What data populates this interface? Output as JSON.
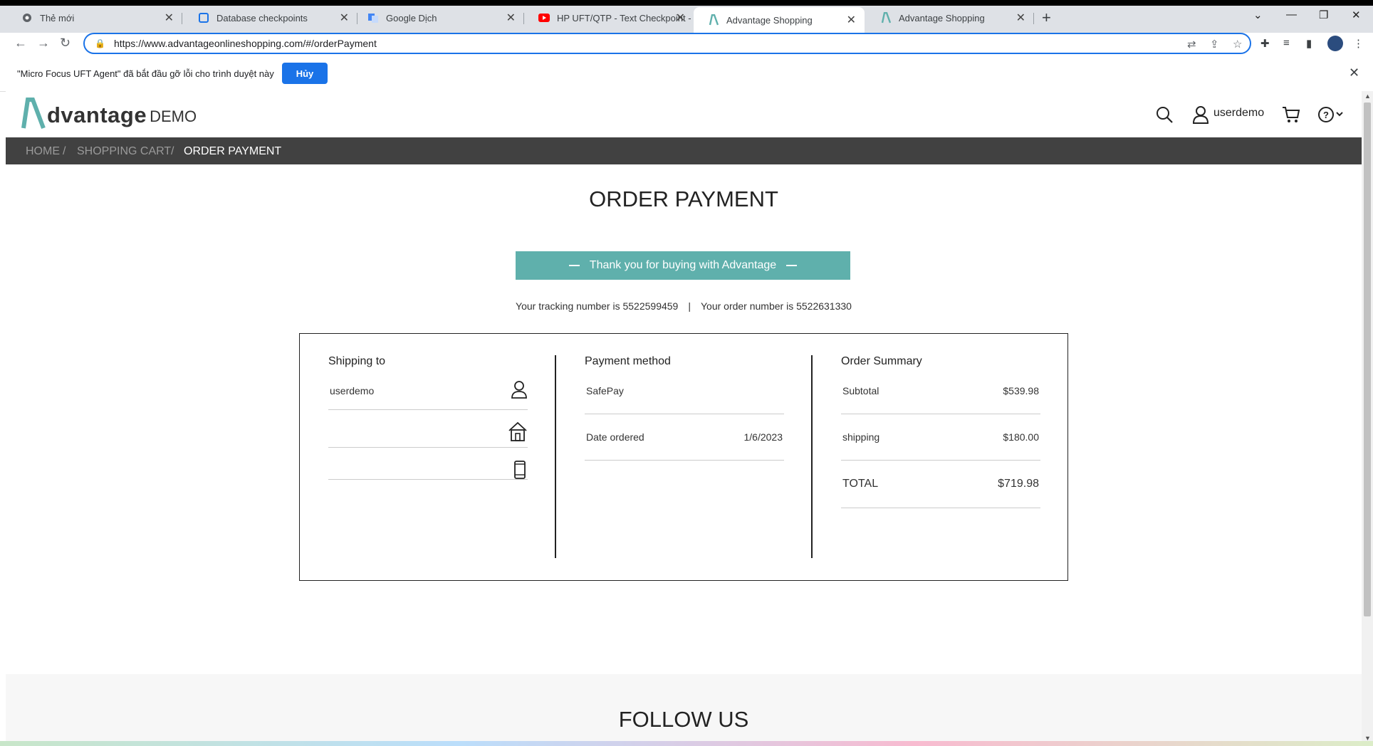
{
  "browser": {
    "tabs": [
      {
        "label": "Thẻ mới",
        "favicon": "chrome-icon"
      },
      {
        "label": "Database checkpoints",
        "favicon": "page-icon"
      },
      {
        "label": "Google Dịch",
        "favicon": "google-translate-icon"
      },
      {
        "label": "HP UFT/QTP - Text Checkpoint -",
        "favicon": "youtube-icon"
      },
      {
        "label": "Advantage Shopping",
        "favicon": "advantage-icon"
      },
      {
        "label": "Advantage Shopping",
        "favicon": "advantage-icon"
      }
    ],
    "active_tab": 4,
    "url": "https://www.advantageonlineshopping.com/#/orderPayment",
    "infobar": {
      "message": "\"Micro Focus UFT Agent\" đã bắt đầu gỡ lỗi cho trình duyệt này",
      "button": "Hủy"
    }
  },
  "site": {
    "logo_word": "dvantage",
    "logo_demo": "DEMO",
    "username": "userdemo",
    "breadcrumb": [
      "HOME",
      "SHOPPING CART",
      "ORDER PAYMENT"
    ],
    "breadcrumb_sep": "/"
  },
  "order": {
    "title": "ORDER PAYMENT",
    "thanks": "Thank you for buying with Advantage",
    "tracking_text": "Your tracking number is 5522599459",
    "order_text": "Your order number is 5522631330",
    "shipping": {
      "heading": "Shipping to",
      "name": "userdemo"
    },
    "payment": {
      "heading": "Payment method",
      "method": "SafePay",
      "date_label": "Date ordered",
      "date_value": "1/6/2023"
    },
    "summary": {
      "heading": "Order Summary",
      "subtotal_label": "Subtotal",
      "subtotal_value": "$539.98",
      "shipping_label": "shipping",
      "shipping_value": "$180.00",
      "total_label": "TOTAL",
      "total_value": "$719.98"
    }
  },
  "footer": {
    "follow": "FOLLOW US"
  },
  "colors": {
    "accent": "#5fb0ac",
    "breadcrumb_bg": "#414141",
    "chrome_blue": "#1a73e8"
  }
}
